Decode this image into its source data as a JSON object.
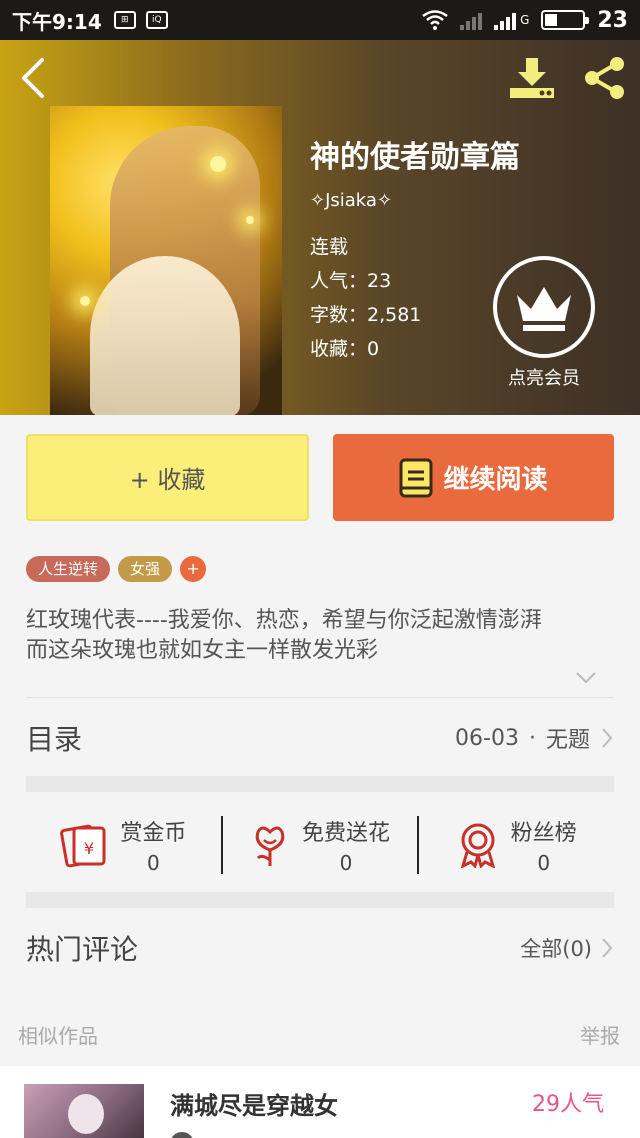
{
  "status_bar": {
    "time": "下午9:14",
    "icon_a": "app-notification-icon",
    "icon_b": "iqiyi-icon",
    "network": "G",
    "battery": "23"
  },
  "header": {
    "icons": [
      "back-arrow-icon",
      "download-icon",
      "share-icon"
    ],
    "background_colors": [
      "#c9a414",
      "#3d3026"
    ]
  },
  "book": {
    "title": "神的使者勋章篇",
    "author": "✧Jsiaka✧",
    "status": "连载",
    "popularity": "人气：23",
    "word_count": "字数：2,581",
    "favorites": "收藏：0"
  },
  "vip": {
    "label": "点亮会员",
    "icon": "crown-icon"
  },
  "actions": {
    "collect_label": "+ 收藏",
    "read_label": "继续阅读",
    "read_color": "#e96a3d",
    "collect_color": "#fbef7a"
  },
  "tags": [
    {
      "label": "人生逆转",
      "color": "#c86a5a"
    },
    {
      "label": "女强",
      "color": "#c29a4a"
    }
  ],
  "tag_add": "+",
  "description": {
    "line1": "红玫瑰代表----我爱你、热恋，希望与你泛起激情澎湃",
    "line2": "而这朵玫瑰也就如女主一样散发光彩"
  },
  "catalog": {
    "heading": "目录",
    "latest_date": "06-03",
    "separator": "·",
    "latest_title": "无题"
  },
  "stats": [
    {
      "name": "赏金币",
      "value": "0",
      "icon": "red-envelope-icon"
    },
    {
      "name": "免费送花",
      "value": "0",
      "icon": "flower-icon"
    },
    {
      "name": "粉丝榜",
      "value": "0",
      "icon": "ribbon-badge-icon"
    }
  ],
  "comments": {
    "heading": "热门评论",
    "all_label": "全部(0)"
  },
  "similar": {
    "section_label": "相似作品",
    "report_label": "举报",
    "items": [
      {
        "title": "满城尽是穿越女",
        "popularity": "29人气"
      }
    ]
  }
}
